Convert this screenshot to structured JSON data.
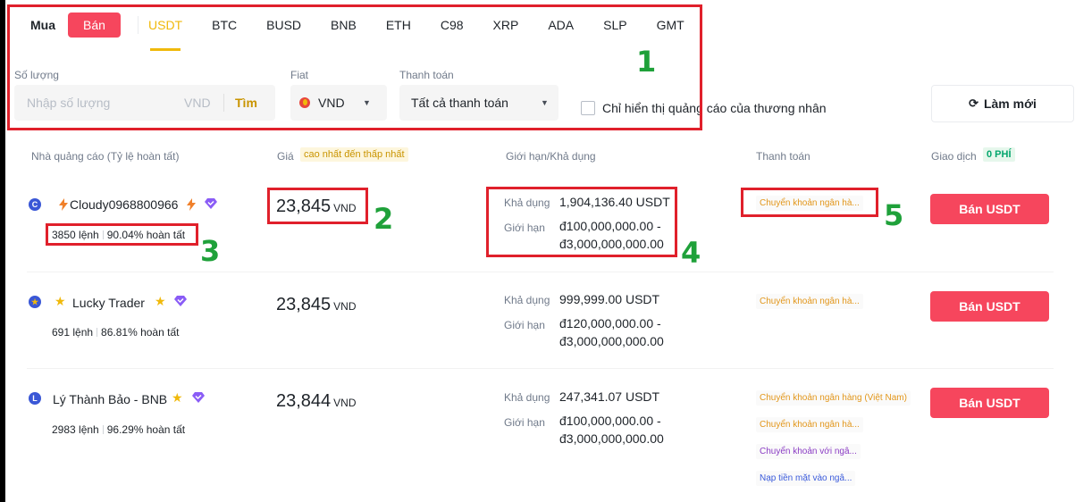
{
  "tabs": {
    "buy": "Mua",
    "sell": "Bán"
  },
  "coins": [
    "USDT",
    "BTC",
    "BUSD",
    "BNB",
    "ETH",
    "C98",
    "XRP",
    "ADA",
    "SLP",
    "GMT"
  ],
  "filters": {
    "amount_label": "Số lượng",
    "amount_placeholder": "Nhập số lượng",
    "amount_unit": "VND",
    "search": "Tìm",
    "fiat_label": "Fiat",
    "fiat_value": "VND",
    "payment_label": "Thanh toán",
    "payment_value": "Tất cả thanh toán",
    "merchant_only": "Chỉ hiển thị quảng cáo của thương nhân",
    "refresh": "Làm mới"
  },
  "table": {
    "headers": {
      "advertiser": "Nhà quảng cáo (Tỷ lệ hoàn tất)",
      "price": "Giá",
      "price_sort": "cao nhất đến thấp nhất",
      "limit": "Giới hạn/Khả dụng",
      "payment": "Thanh toán",
      "trade": "Giao dịch",
      "fee": "0 PHÍ"
    },
    "available_label": "Khả dụng",
    "limit_label": "Giới hạn",
    "rows": [
      {
        "avatar": "C",
        "name": "Cloudy0968800966",
        "orders": "3850 lệnh",
        "completion": "90.04% hoàn tất",
        "price": "23,845",
        "currency": "VND",
        "available": "1,904,136.40 USDT",
        "limit_min": "đ100,000,000.00 -",
        "limit_max": "đ3,000,000,000.00",
        "payments": [
          "Chuyển khoản ngân hà..."
        ],
        "action": "Bán USDT"
      },
      {
        "avatar": "L",
        "name": "Lucky Trader",
        "orders": "691 lệnh",
        "completion": "86.81% hoàn tất",
        "price": "23,845",
        "currency": "VND",
        "available": "999,999.00 USDT",
        "limit_min": "đ120,000,000.00 -",
        "limit_max": "đ3,000,000,000.00",
        "payments": [
          "Chuyển khoản ngân hà..."
        ],
        "action": "Bán USDT"
      },
      {
        "avatar": "L",
        "name": "Lý Thành Bảo - BNB",
        "orders": "2983 lệnh",
        "completion": "96.29% hoàn tất",
        "price": "23,844",
        "currency": "VND",
        "available": "247,341.07 USDT",
        "limit_min": "đ100,000,000.00 -",
        "limit_max": "đ3,000,000,000.00",
        "payments": [
          "Chuyển khoản ngân hàng (Việt Nam)",
          "Chuyển khoản ngân hà...",
          "Chuyển khoản với ngâ...",
          "Nạp tiền mặt vào ngâ..."
        ],
        "action": "Bán USDT"
      }
    ]
  },
  "annotations": [
    "1",
    "2",
    "3",
    "4",
    "5"
  ],
  "colors": {
    "accent": "#f0b90b",
    "sell": "#f6465d",
    "annotation_box": "#e0202b",
    "annotation_number": "#1fa13a"
  }
}
